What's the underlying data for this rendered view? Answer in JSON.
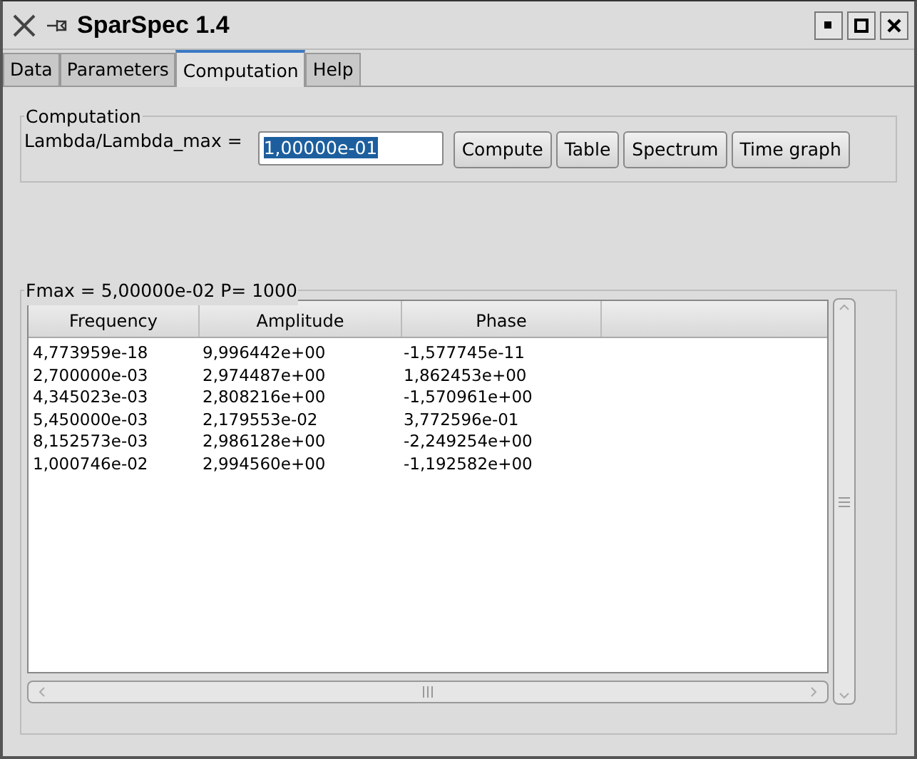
{
  "window": {
    "title": "SparSpec 1.4"
  },
  "tabs": [
    {
      "label": "Data",
      "selected": false
    },
    {
      "label": "Parameters",
      "selected": false
    },
    {
      "label": "Computation",
      "selected": true
    },
    {
      "label": "Help",
      "selected": false
    }
  ],
  "computation": {
    "title": "Computation",
    "label": "Lambda/Lambda_max =",
    "value": "1,00000e-01",
    "value_selected": true,
    "buttons": [
      "Compute",
      "Table",
      "Spectrum",
      "Time graph"
    ]
  },
  "results": {
    "title": "Fmax = 5,00000e-02  P= 1000",
    "columns": [
      "Frequency",
      "Amplitude",
      "Phase"
    ],
    "rows": [
      [
        "4,773959e-18",
        "9,996442e+00",
        "-1,577745e-11"
      ],
      [
        "2,700000e-03",
        "2,974487e+00",
        "1,862453e+00"
      ],
      [
        "4,345023e-03",
        "2,808216e+00",
        "-1,570961e+00"
      ],
      [
        "5,450000e-03",
        "2,179553e-02",
        "3,772596e-01"
      ],
      [
        "8,152573e-03",
        "2,986128e+00",
        "-2,249254e+00"
      ],
      [
        "1,000746e-02",
        "2,994560e+00",
        "-1,192582e+00"
      ]
    ]
  }
}
